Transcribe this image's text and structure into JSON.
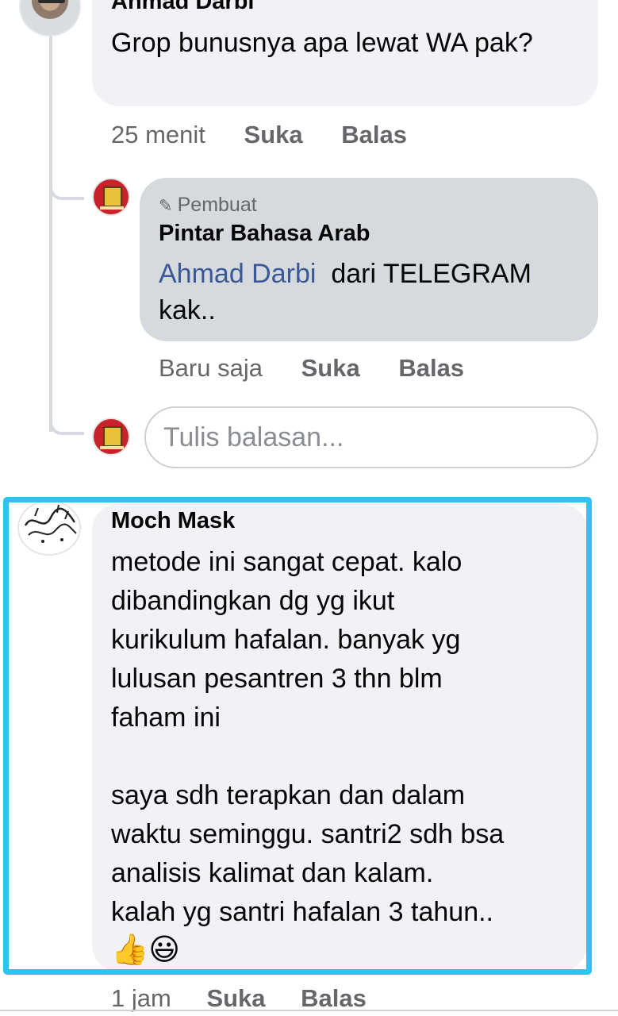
{
  "comments": [
    {
      "author": "Ahmad Darbi",
      "text": "Grop bunusnya apa lewat WA pak?",
      "time": "25 menit",
      "like_label": "Suka",
      "reply_label": "Balas"
    },
    {
      "author_badge": "Pembuat",
      "author": "Pintar Bahasa Arab",
      "mention": "Ahmad Darbi",
      "text": "dari TELEGRAM kak..",
      "time": "Baru saja",
      "like_label": "Suka",
      "reply_label": "Balas"
    }
  ],
  "reply_box": {
    "placeholder": "Tulis balasan..."
  },
  "highlighted_comment": {
    "author": "Moch Mask",
    "text": "metode ini sangat cepat. kalo\ndibandingkan dg yg ikut\nkurikulum hafalan. banyak yg\nlulusan pesantren 3 thn blm\nfaham ini\n\nsaya sdh terapkan dan dalam\nwaktu seminggu. santri2 sdh bsa\nanalisis kalimat dan kalam.\nkalah yg santri hafalan 3 tahun..",
    "emojis": "👍😃",
    "time": "1 jam",
    "like_label": "Suka",
    "reply_label": "Balas"
  },
  "colors": {
    "highlight_border": "#2ec4f2",
    "mention": "#385898",
    "bubble_light": "#f0f2f5",
    "bubble_author": "#d6d9dd"
  },
  "icons": [
    "pencil-icon"
  ]
}
